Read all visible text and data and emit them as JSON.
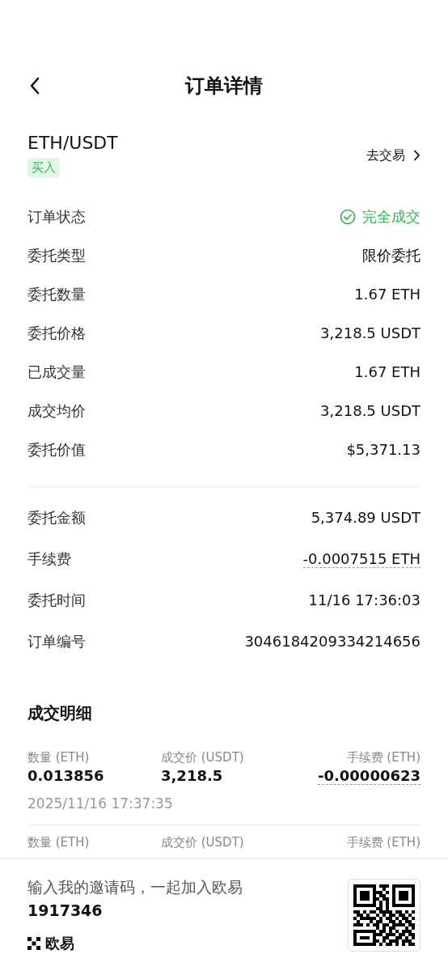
{
  "header": {
    "title": "订单详情"
  },
  "pair": {
    "symbol": "ETH/USDT",
    "side": "买入",
    "link": "去交易"
  },
  "rows": [
    {
      "kind": "status",
      "label": "订单状态",
      "value": "完全成交"
    },
    {
      "kind": "plain",
      "label": "委托类型",
      "value": "限价委托"
    },
    {
      "kind": "plain",
      "label": "委托数量",
      "value": "1.67 ETH"
    },
    {
      "kind": "plain",
      "label": "委托价格",
      "value": "3,218.5 USDT"
    },
    {
      "kind": "plain",
      "label": "已成交量",
      "value": "1.67 ETH"
    },
    {
      "kind": "plain",
      "label": "成交均价",
      "value": "3,218.5 USDT"
    },
    {
      "kind": "plain",
      "label": "委托价值",
      "value": "$5,371.13"
    }
  ],
  "rows2": [
    {
      "kind": "plain",
      "label": "委托金额",
      "value": "5,374.89 USDT"
    },
    {
      "kind": "dashed",
      "label": "手续费",
      "value": "-0.0007515 ETH"
    },
    {
      "kind": "plain",
      "label": "委托时间",
      "value": "11/16 17:36:03"
    },
    {
      "kind": "plain",
      "label": "订单编号",
      "value": "3046184209334214656"
    }
  ],
  "fills": {
    "title": "成交明细",
    "items": [
      {
        "qty_label": "数量 (ETH)",
        "qty": "0.013856",
        "price_label": "成交价 (USDT)",
        "price": "3,218.5",
        "fee_label": "手续费 (ETH)",
        "fee": "-0.00000623",
        "time": "2025/11/16 17:37:35"
      },
      {
        "qty_label": "数量 (ETH)",
        "price_label": "成交价 (USDT)",
        "fee_label": "手续费 (ETH)"
      }
    ]
  },
  "footer": {
    "invite": "输入我的邀请码，一起加入欧易",
    "code": "1917346",
    "brand": "欧易"
  }
}
